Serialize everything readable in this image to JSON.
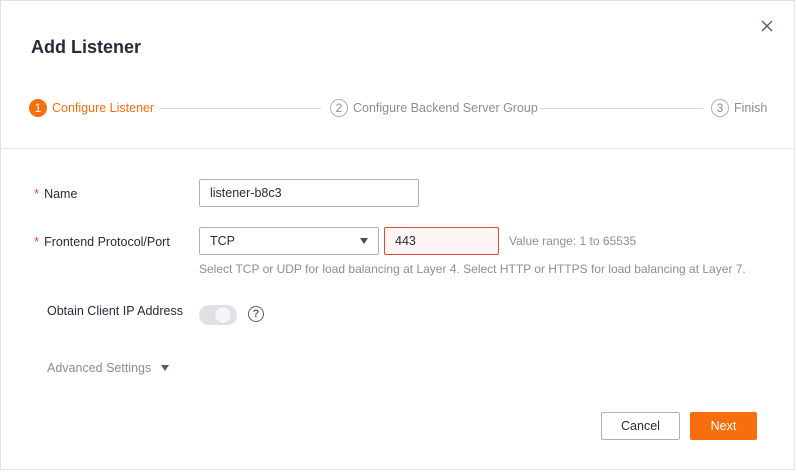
{
  "dialog": {
    "title": "Add Listener",
    "close_icon": "close-icon"
  },
  "steps": [
    {
      "number": "1",
      "label": "Configure Listener",
      "state": "active"
    },
    {
      "number": "2",
      "label": "Configure Backend Server Group",
      "state": "pending"
    },
    {
      "number": "3",
      "label": "Finish",
      "state": "pending"
    }
  ],
  "form": {
    "name": {
      "label": "Name",
      "required_mark": "*",
      "value": "listener-b8c3"
    },
    "protocol_port": {
      "label": "Frontend Protocol/Port",
      "required_mark": "*",
      "protocol_value": "TCP",
      "port_value": "443",
      "range_hint": "Value range: 1 to 65535",
      "help_text": "Select TCP or UDP for load balancing at Layer 4. Select HTTP or HTTPS for load balancing at Layer 7."
    },
    "client_ip": {
      "label": "Obtain Client IP Address",
      "toggle_state": "on-disabled",
      "help_icon": "question-circle-icon",
      "help_glyph": "?"
    },
    "advanced": {
      "label": "Advanced Settings"
    }
  },
  "footer": {
    "cancel_label": "Cancel",
    "next_label": "Next"
  },
  "colors": {
    "accent": "#f66f0c",
    "error": "#e5463b",
    "text": "#252b3a",
    "muted": "#8a8e99"
  }
}
